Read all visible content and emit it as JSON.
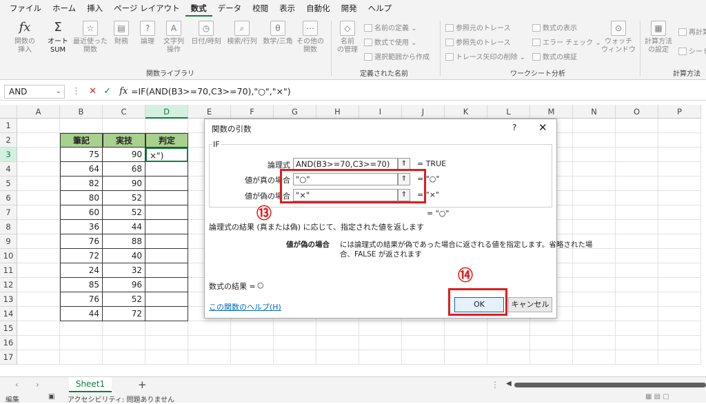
{
  "menu": [
    "ファイル",
    "ホーム",
    "挿入",
    "ページ レイアウト",
    "数式",
    "データ",
    "校閲",
    "表示",
    "自動化",
    "開発",
    "ヘルプ"
  ],
  "active_menu_index": 4,
  "ribbon": {
    "fx_label": "関数の\n挿入",
    "autosum_label": "オート\nSUM",
    "recent_label": "最近使った\n関数",
    "finance_label": "財務",
    "logic_label": "論理",
    "text_label": "文字列\n操作",
    "datetime_label": "日付/時刻",
    "lookup_label": "検索/行列",
    "math_label": "数学/三角",
    "more_label": "その他の\n関数",
    "group_library": "関数ライブラリ",
    "name_manager_label": "名前\nの管理",
    "define_name": "名前の定義",
    "use_in_formula": "数式で使用",
    "create_from_selection": "選択範囲から作成",
    "group_names": "定義された名前",
    "trace_precedents": "参照元のトレース",
    "trace_dependents": "参照先のトレース",
    "remove_arrows": "トレース矢印の削除",
    "show_formulas": "数式の表示",
    "error_check": "エラー チェック",
    "evaluate_formula": "数式の検証",
    "group_audit": "ワークシート分析",
    "watch_label": "ウォッチ\nウィンドウ",
    "calc_options_label": "計算方法\nの設定",
    "recalc": "再計算",
    "sheet_calc": "シート",
    "group_calc": "計算方法"
  },
  "formula_bar": {
    "name_box": "AND",
    "formula": "=IF(AND(B3>=70,C3>=70),\"○\",\"×\")"
  },
  "columns": [
    "A",
    "B",
    "C",
    "D",
    "E",
    "F",
    "G",
    "H",
    "I",
    "J",
    "K",
    "L",
    "M",
    "N",
    "O",
    "P"
  ],
  "rows": [
    "1",
    "2",
    "3",
    "4",
    "5",
    "6",
    "7",
    "8",
    "9",
    "10",
    "11",
    "12",
    "13",
    "14",
    "15",
    "16",
    "17"
  ],
  "table": {
    "headers": [
      "筆記",
      "実技",
      "判定"
    ],
    "data": [
      [
        "75",
        "90"
      ],
      [
        "64",
        "68"
      ],
      [
        "82",
        "90"
      ],
      [
        "80",
        "52"
      ],
      [
        "60",
        "52"
      ],
      [
        "36",
        "44"
      ],
      [
        "76",
        "88"
      ],
      [
        "72",
        "40"
      ],
      [
        "24",
        "32"
      ],
      [
        "85",
        "96"
      ],
      [
        "76",
        "52"
      ],
      [
        "44",
        "72"
      ]
    ],
    "active_cell_text": "×\")"
  },
  "dialog": {
    "title": "関数の引数",
    "help_symbol": "?",
    "close_symbol": "✕",
    "func_name": "IF",
    "args": [
      {
        "label": "論理式",
        "value": "AND(B3>=70,C3>=70)",
        "result": "=  TRUE"
      },
      {
        "label": "値が真の場合",
        "value": "\"○\"",
        "result": "=  \"○\""
      },
      {
        "label": "値が偽の場合",
        "value": "\"×\"",
        "result": "=  \"×\""
      }
    ],
    "overall_result": "=  \"○\"",
    "description": "論理式の結果 (真または偽) に応じて、指定された値を返します",
    "arg_desc_name": "値が偽の場合",
    "arg_desc_text": "には論理式の結果が偽であった場合に返される値を指定します。省略された場",
    "arg_desc_text2": "合、FALSE が返されます",
    "formula_result_label": "数式の結果 =",
    "formula_result_value": "○",
    "help_link": "この関数のヘルプ(H)",
    "ok": "OK",
    "cancel": "キャンセル"
  },
  "annotations": {
    "step13": "⑬",
    "step14": "⑭"
  },
  "sheet": {
    "tab": "Sheet1",
    "add": "+"
  },
  "status": {
    "mode": "編集",
    "accessibility": "アクセシビリティ: 問題ありません"
  }
}
